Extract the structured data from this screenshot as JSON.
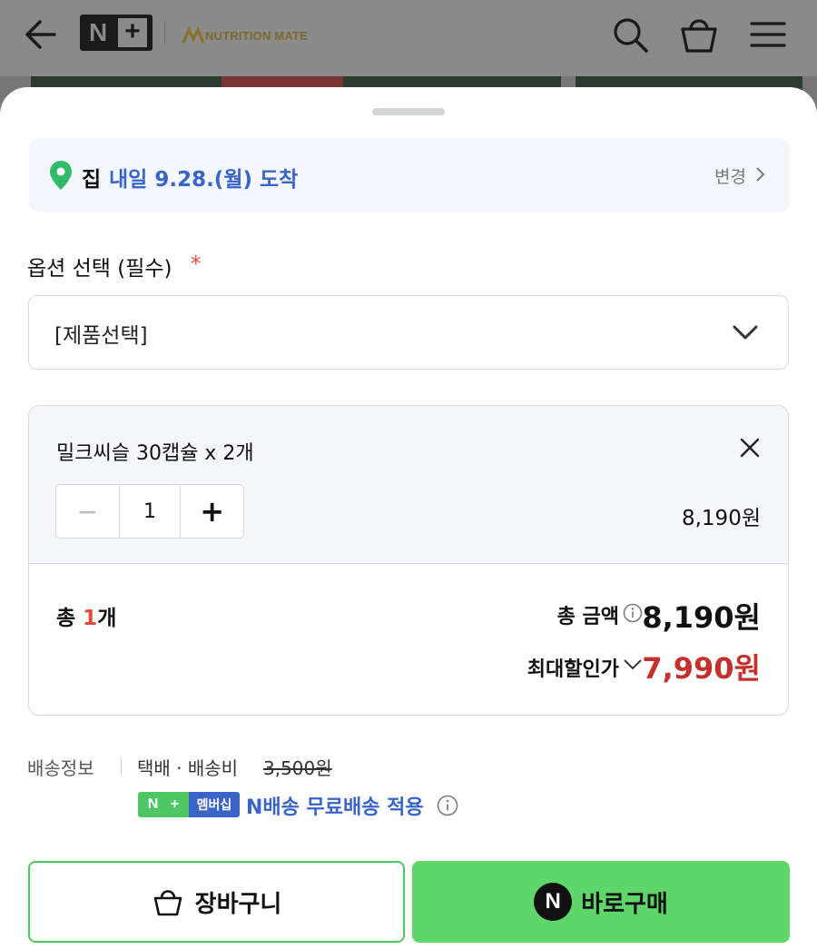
{
  "header": {
    "logo_n": "N",
    "logo_plus": "+",
    "brand": "NUTRITION MATE",
    "icons": [
      "back-arrow-icon",
      "search-icon",
      "shopping-bag-icon",
      "menu-icon"
    ]
  },
  "delivery": {
    "place": "집",
    "eta": "내일 9.28.(월) 도착",
    "change": "변경"
  },
  "option": {
    "label": "옵션 선택 (필수)",
    "required_mark": "*",
    "selected": "[제품선택]"
  },
  "cart_item": {
    "name": "밀크씨슬 30캡슐 x 2개",
    "quantity": "1",
    "minus": "−",
    "plus": "+",
    "price": "8,190원"
  },
  "totals": {
    "count_prefix": "총 ",
    "count": "1",
    "count_suffix": "개",
    "total_label": "총 금액",
    "total_amount": "8,190원",
    "discount_label": "최대할인가",
    "discount_amount": "7,990원"
  },
  "shipping": {
    "label": "배송정보",
    "method": "택배 · 배송비",
    "fee": "3,500원",
    "badge_n": "N",
    "badge_plus": "+",
    "badge_member": "멤버십",
    "free_text": "N배송 무료배송 적용"
  },
  "actions": {
    "cart_label": "장바구니",
    "buy_logo": "N",
    "buy_label": "바로구매"
  },
  "colors": {
    "accent_green": "#5ed669",
    "link_blue": "#3a64c8",
    "discount_red": "#c4302b",
    "required_red": "#e0473e"
  }
}
